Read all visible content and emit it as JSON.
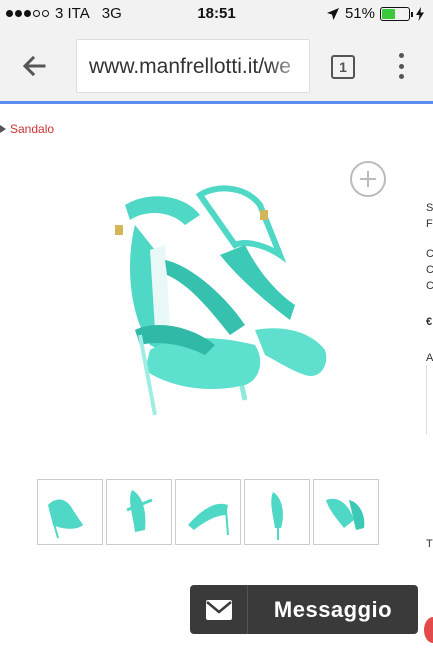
{
  "status_bar": {
    "carrier": "3 ITA",
    "network": "3G",
    "time": "18:51",
    "battery_percent": "51%",
    "battery_level": 0.51,
    "signal_bars_filled": 3,
    "signal_bars_total": 5
  },
  "browser": {
    "url": "www.manfrellotti.it/we",
    "tab_count": "1"
  },
  "page": {
    "breadcrumb": "Sandalo",
    "side_letters": [
      "S",
      "F",
      "C",
      "C",
      "C",
      "€",
      "A",
      "T"
    ],
    "thumbnail_count": 5
  },
  "message_button": {
    "label": "Messaggio"
  },
  "colors": {
    "accent_blue": "#5b8dee",
    "breadcrumb_red": "#cc3333",
    "product_turquoise": "#4fd8c6",
    "message_bg": "#3a3a3a"
  },
  "icons": {
    "back": "arrow-left-icon",
    "menu": "vertical-dots-icon",
    "zoom": "plus-circle-icon",
    "message": "envelope-icon",
    "location": "location-arrow-icon",
    "charging": "bolt-icon"
  }
}
